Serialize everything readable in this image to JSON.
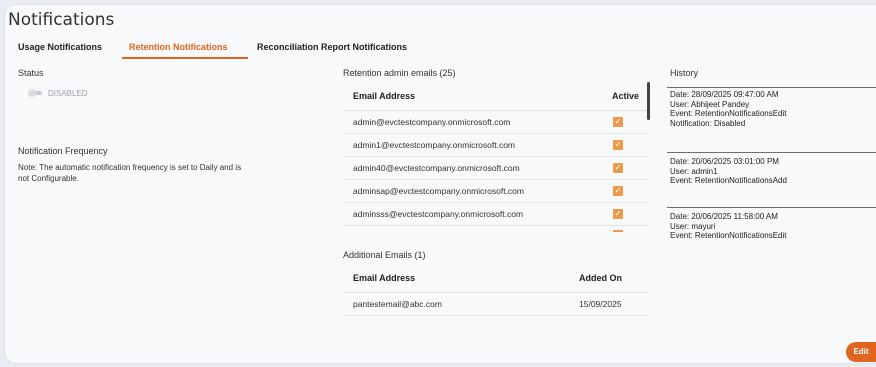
{
  "page": {
    "title": "Notifications"
  },
  "tabs": [
    {
      "label": "Usage Notifications",
      "active": false
    },
    {
      "label": "Retention Notifications",
      "active": true
    },
    {
      "label": "Reconciliation Report Notifications",
      "active": false
    }
  ],
  "status": {
    "label": "Status",
    "toggle_state": "DISABLED"
  },
  "frequency": {
    "heading": "Notification Frequency",
    "note_line1": "Note: The automatic notification frequency is set to Daily and is",
    "note_line2": "not Configurable."
  },
  "retention_admin_emails": {
    "heading": "Retention admin emails (25)",
    "columns": {
      "email": "Email Address",
      "active": "Active"
    },
    "rows": [
      {
        "email": "admin@evctestcompany.onmicrosoft.com",
        "active": true
      },
      {
        "email": "admin1@evctestcompany.onmicrosoft.com",
        "active": true
      },
      {
        "email": "admin40@evctestcompany.onmicrosoft.com",
        "active": true
      },
      {
        "email": "adminsap@evctestcompany.onmicrosoft.com",
        "active": true
      },
      {
        "email": "adminsss@evctestcompany.onmicrosoft.com",
        "active": true
      }
    ]
  },
  "additional_emails": {
    "heading": "Additional Emails (1)",
    "columns": {
      "email": "Email Address",
      "added_on": "Added On"
    },
    "rows": [
      {
        "email": "pantestemail@abc.com",
        "added_on": "15/09/2025"
      }
    ]
  },
  "history": {
    "heading": "History",
    "entries": [
      {
        "date": "Date: 28/09/2025 09:47:00 AM",
        "user": "User: Abhijeet Pandey",
        "event": "Event: RetentionNotificationsEdit",
        "extra": "Notification: Disabled"
      },
      {
        "date": "Date: 20/06/2025 03:01:00 PM",
        "user": "User: admin1",
        "event": "Event: RetentionNotificationsAdd"
      },
      {
        "date": "Date: 20/06/2025 11:58:00 AM",
        "user": "User: mayuri",
        "event": "Event: RetentionNotificationsEdit"
      }
    ]
  },
  "actions": {
    "edit_label": "Edit"
  },
  "colors": {
    "accent": "#e0651e",
    "checkbox": "#ef9a4a"
  }
}
